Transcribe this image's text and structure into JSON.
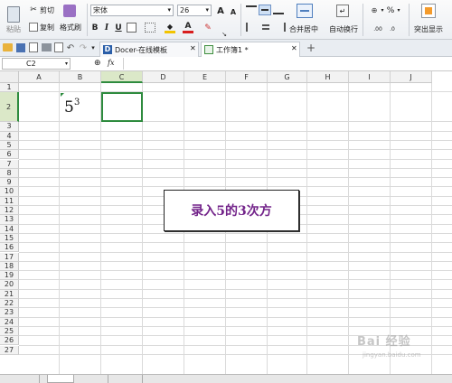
{
  "ribbon": {
    "paste": "粘贴",
    "cut": "剪切",
    "copy": "复制",
    "format_painter": "格式刷",
    "font_name": "宋体",
    "font_size": "26",
    "merge_center": "合并居中",
    "wrap_text": "自动换行",
    "highlight": "突出显示",
    "percent": "%",
    "currency": "¥",
    "grow_font": "A",
    "shrink_font": "A",
    "bold": "B",
    "italic": "I",
    "underline": "U"
  },
  "tabs": [
    {
      "label": "Docer-在线模板"
    },
    {
      "label": "工作簿1 *"
    }
  ],
  "formula_bar": {
    "name_box": "C2",
    "fx": "fx",
    "zoom": "⊕"
  },
  "columns": [
    "A",
    "B",
    "C",
    "D",
    "E",
    "F",
    "G",
    "H",
    "I",
    "J"
  ],
  "rows": [
    "1",
    "2",
    "3",
    "4",
    "5",
    "6",
    "7",
    "8",
    "9",
    "10",
    "11",
    "12",
    "13",
    "14",
    "15",
    "16",
    "17",
    "18",
    "19",
    "20",
    "21",
    "22",
    "23",
    "24",
    "25",
    "26",
    "27"
  ],
  "cell_b2": {
    "base": "5",
    "exponent": "3"
  },
  "callout": "录入5的3次方",
  "watermark": "Bai 经验",
  "watermark_url": "jingyan.baidu.com",
  "colors": {
    "accent": "#73248a",
    "selection": "#2e8b3e"
  }
}
